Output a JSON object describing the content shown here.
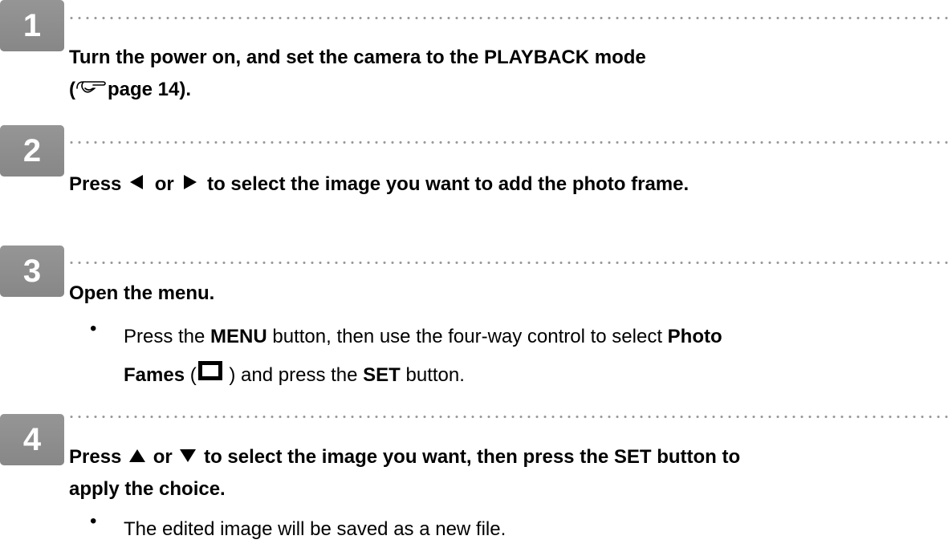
{
  "steps": [
    {
      "number": "1",
      "heading_line1": "Turn the power on, and set the camera to the PLAYBACK mode",
      "heading_line2_prefix": "(",
      "heading_line2_ref": "page 14).",
      "icon": "hand-pointing-icon"
    },
    {
      "number": "2",
      "heading_part1": "Press",
      "heading_part2": "or",
      "heading_part3": "to select the image you want to add the photo frame.",
      "icons": [
        "arrow-left-icon",
        "arrow-right-icon"
      ]
    },
    {
      "number": "3",
      "heading": "Open the menu.",
      "bullet": {
        "t1": "Press the ",
        "b1": "MENU",
        "t2": " button, then use the four-way control to select ",
        "b2": "Photo",
        "b3": "Fames",
        "t3": " (",
        "t4": " ) and press the ",
        "b4": "SET",
        "t5": " button.",
        "icon": "photo-frame-icon"
      }
    },
    {
      "number": "4",
      "heading_part1": "Press",
      "heading_part2": "or",
      "heading_part3": "to select the image you want, then press the SET button to",
      "heading_line2": "apply the choice.",
      "icons": [
        "arrow-up-icon",
        "arrow-down-icon"
      ],
      "bullet": "The edited image will be saved as a new file."
    }
  ],
  "bullet_char": "•"
}
